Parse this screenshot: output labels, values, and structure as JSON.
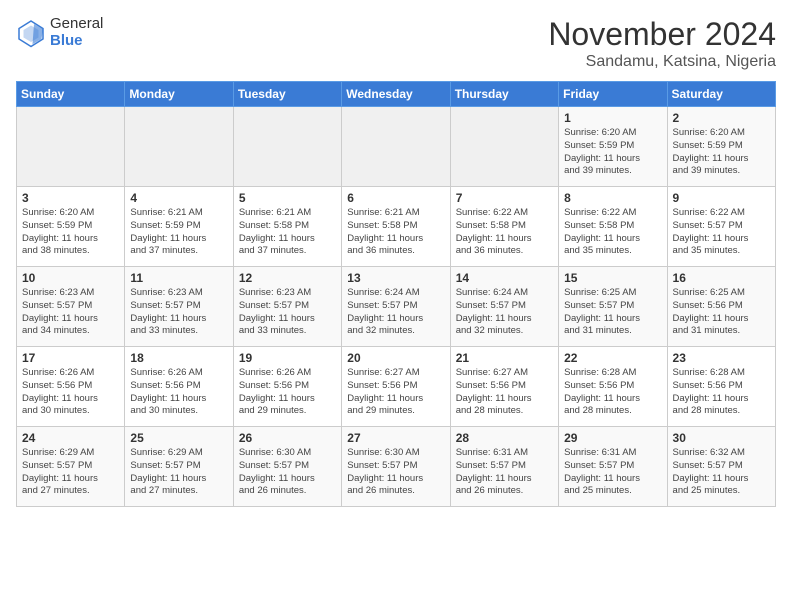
{
  "header": {
    "logo_general": "General",
    "logo_blue": "Blue",
    "month_year": "November 2024",
    "location": "Sandamu, Katsina, Nigeria"
  },
  "weekdays": [
    "Sunday",
    "Monday",
    "Tuesday",
    "Wednesday",
    "Thursday",
    "Friday",
    "Saturday"
  ],
  "weeks": [
    [
      {
        "day": "",
        "info": ""
      },
      {
        "day": "",
        "info": ""
      },
      {
        "day": "",
        "info": ""
      },
      {
        "day": "",
        "info": ""
      },
      {
        "day": "",
        "info": ""
      },
      {
        "day": "1",
        "info": "Sunrise: 6:20 AM\nSunset: 5:59 PM\nDaylight: 11 hours\nand 39 minutes."
      },
      {
        "day": "2",
        "info": "Sunrise: 6:20 AM\nSunset: 5:59 PM\nDaylight: 11 hours\nand 39 minutes."
      }
    ],
    [
      {
        "day": "3",
        "info": "Sunrise: 6:20 AM\nSunset: 5:59 PM\nDaylight: 11 hours\nand 38 minutes."
      },
      {
        "day": "4",
        "info": "Sunrise: 6:21 AM\nSunset: 5:59 PM\nDaylight: 11 hours\nand 37 minutes."
      },
      {
        "day": "5",
        "info": "Sunrise: 6:21 AM\nSunset: 5:58 PM\nDaylight: 11 hours\nand 37 minutes."
      },
      {
        "day": "6",
        "info": "Sunrise: 6:21 AM\nSunset: 5:58 PM\nDaylight: 11 hours\nand 36 minutes."
      },
      {
        "day": "7",
        "info": "Sunrise: 6:22 AM\nSunset: 5:58 PM\nDaylight: 11 hours\nand 36 minutes."
      },
      {
        "day": "8",
        "info": "Sunrise: 6:22 AM\nSunset: 5:58 PM\nDaylight: 11 hours\nand 35 minutes."
      },
      {
        "day": "9",
        "info": "Sunrise: 6:22 AM\nSunset: 5:57 PM\nDaylight: 11 hours\nand 35 minutes."
      }
    ],
    [
      {
        "day": "10",
        "info": "Sunrise: 6:23 AM\nSunset: 5:57 PM\nDaylight: 11 hours\nand 34 minutes."
      },
      {
        "day": "11",
        "info": "Sunrise: 6:23 AM\nSunset: 5:57 PM\nDaylight: 11 hours\nand 33 minutes."
      },
      {
        "day": "12",
        "info": "Sunrise: 6:23 AM\nSunset: 5:57 PM\nDaylight: 11 hours\nand 33 minutes."
      },
      {
        "day": "13",
        "info": "Sunrise: 6:24 AM\nSunset: 5:57 PM\nDaylight: 11 hours\nand 32 minutes."
      },
      {
        "day": "14",
        "info": "Sunrise: 6:24 AM\nSunset: 5:57 PM\nDaylight: 11 hours\nand 32 minutes."
      },
      {
        "day": "15",
        "info": "Sunrise: 6:25 AM\nSunset: 5:57 PM\nDaylight: 11 hours\nand 31 minutes."
      },
      {
        "day": "16",
        "info": "Sunrise: 6:25 AM\nSunset: 5:56 PM\nDaylight: 11 hours\nand 31 minutes."
      }
    ],
    [
      {
        "day": "17",
        "info": "Sunrise: 6:26 AM\nSunset: 5:56 PM\nDaylight: 11 hours\nand 30 minutes."
      },
      {
        "day": "18",
        "info": "Sunrise: 6:26 AM\nSunset: 5:56 PM\nDaylight: 11 hours\nand 30 minutes."
      },
      {
        "day": "19",
        "info": "Sunrise: 6:26 AM\nSunset: 5:56 PM\nDaylight: 11 hours\nand 29 minutes."
      },
      {
        "day": "20",
        "info": "Sunrise: 6:27 AM\nSunset: 5:56 PM\nDaylight: 11 hours\nand 29 minutes."
      },
      {
        "day": "21",
        "info": "Sunrise: 6:27 AM\nSunset: 5:56 PM\nDaylight: 11 hours\nand 28 minutes."
      },
      {
        "day": "22",
        "info": "Sunrise: 6:28 AM\nSunset: 5:56 PM\nDaylight: 11 hours\nand 28 minutes."
      },
      {
        "day": "23",
        "info": "Sunrise: 6:28 AM\nSunset: 5:56 PM\nDaylight: 11 hours\nand 28 minutes."
      }
    ],
    [
      {
        "day": "24",
        "info": "Sunrise: 6:29 AM\nSunset: 5:57 PM\nDaylight: 11 hours\nand 27 minutes."
      },
      {
        "day": "25",
        "info": "Sunrise: 6:29 AM\nSunset: 5:57 PM\nDaylight: 11 hours\nand 27 minutes."
      },
      {
        "day": "26",
        "info": "Sunrise: 6:30 AM\nSunset: 5:57 PM\nDaylight: 11 hours\nand 26 minutes."
      },
      {
        "day": "27",
        "info": "Sunrise: 6:30 AM\nSunset: 5:57 PM\nDaylight: 11 hours\nand 26 minutes."
      },
      {
        "day": "28",
        "info": "Sunrise: 6:31 AM\nSunset: 5:57 PM\nDaylight: 11 hours\nand 26 minutes."
      },
      {
        "day": "29",
        "info": "Sunrise: 6:31 AM\nSunset: 5:57 PM\nDaylight: 11 hours\nand 25 minutes."
      },
      {
        "day": "30",
        "info": "Sunrise: 6:32 AM\nSunset: 5:57 PM\nDaylight: 11 hours\nand 25 minutes."
      }
    ]
  ]
}
